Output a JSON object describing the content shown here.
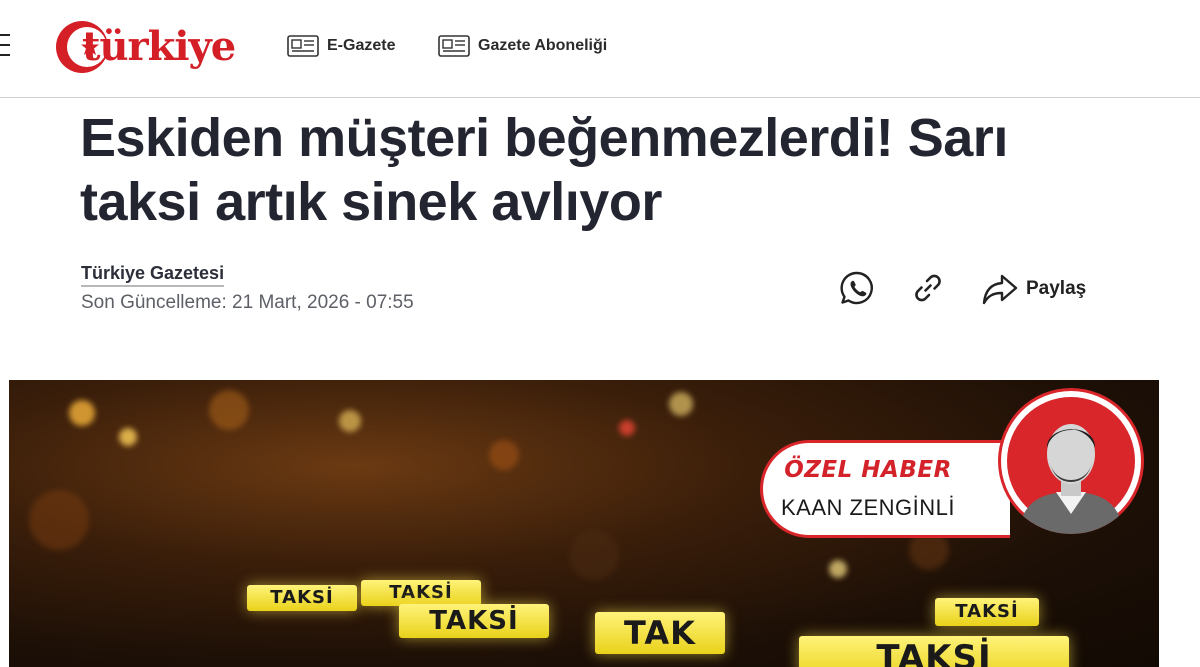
{
  "header": {
    "logo_text": "türkiye",
    "logo_icon": "crescent-star-logo",
    "nav": [
      {
        "label": "E-Gazete",
        "icon": "newspaper-icon"
      },
      {
        "label": "Gazete Aboneliği",
        "icon": "newspaper-icon"
      }
    ]
  },
  "article": {
    "headline": "Eskiden müşteri beğenmezlerdi! Sarı taksi artık sinek avlıyor",
    "author": "Türkiye Gazetesi",
    "updated": "Son Güncelleme: 21 Mart, 2026 - 07:55",
    "share": {
      "whatsapp_icon": "whatsapp-icon",
      "link_icon": "link-icon",
      "share_label": "Paylaş",
      "share_icon": "share-arrow-icon"
    }
  },
  "hero": {
    "taxi_signs": [
      "TAKSİ",
      "TAKSİ",
      "TAKSİ",
      "TAK",
      "TAKSİ",
      "TAKSİ"
    ],
    "badge_label": "ÖZEL HABER",
    "badge_name": "KAAN ZENGİNLİ"
  },
  "colors": {
    "brand_red": "#d41f26",
    "headline": "#232531",
    "meta_gray": "#5e6068",
    "taxi_yellow": "#f2de2c"
  }
}
